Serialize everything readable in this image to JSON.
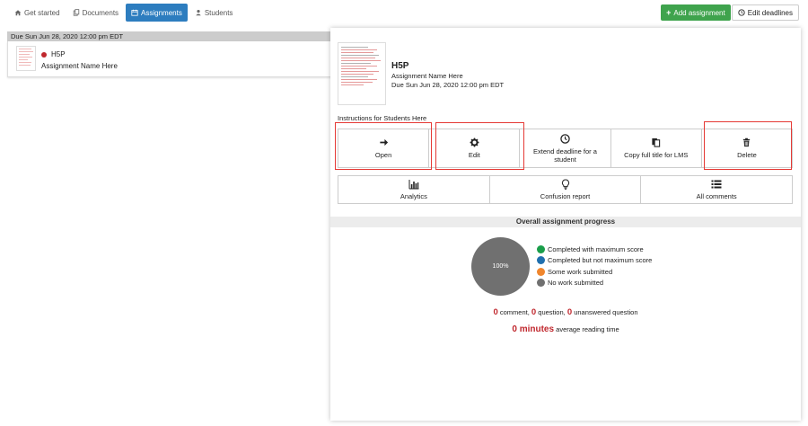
{
  "nav": {
    "tabs": [
      {
        "label": "Get started",
        "icon": "home-icon"
      },
      {
        "label": "Documents",
        "icon": "documents-icon"
      },
      {
        "label": "Assignments",
        "icon": "calendar-icon",
        "active": true
      },
      {
        "label": "Students",
        "icon": "user-icon"
      }
    ],
    "add_label": "Add assignment",
    "edit_deadlines_label": "Edit deadlines"
  },
  "list": {
    "due_header": "Due Sun Jun 28, 2020 12:00 pm EDT",
    "item": {
      "title": "H5P",
      "name": "Assignment Name Here",
      "status_color": "#c0272d"
    }
  },
  "panel": {
    "title": "H5P",
    "name": "Assignment Name Here",
    "due": "Due Sun Jun 28, 2020 12:00 pm EDT",
    "instructions": "Instructions for Students Here",
    "actions": {
      "open": "Open",
      "edit": "Edit",
      "extend": "Extend deadline for a student",
      "copy_title": "Copy full title for LMS",
      "delete": "Delete"
    },
    "stats": {
      "analytics": "Analytics",
      "confusion": "Confusion report",
      "comments": "All comments"
    },
    "progress": {
      "header": "Overall assignment progress",
      "pie_label": "100%",
      "legend": [
        {
          "label": "Completed with maximum score",
          "color": "#1a9e4a"
        },
        {
          "label": "Completed but not maximum score",
          "color": "#1f6fae"
        },
        {
          "label": "Some work submitted",
          "color": "#f0862d"
        },
        {
          "label": "No work submitted",
          "color": "#707070"
        }
      ],
      "comment_count": "0",
      "comment_label": "comment,",
      "question_count": "0",
      "question_label": "question,",
      "unanswered_count": "0",
      "unanswered_label": "unanswered question",
      "reading_value": "0 minutes",
      "reading_label": "average reading time"
    }
  },
  "colors": {
    "accent": "#2d7dbf",
    "add_green": "#3fa34d",
    "highlight": "#e53935"
  }
}
